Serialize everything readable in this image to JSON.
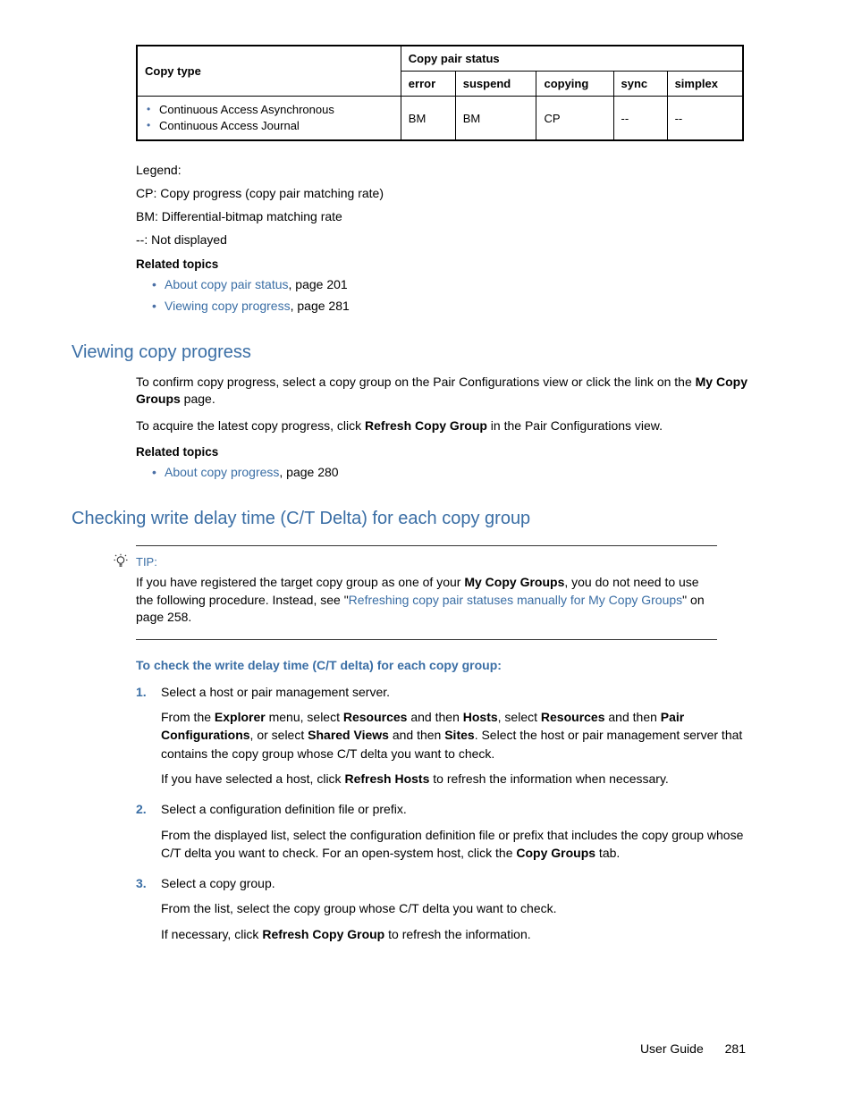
{
  "table": {
    "header_copy_type": "Copy type",
    "header_pair_status": "Copy pair status",
    "cols": {
      "error": "error",
      "suspend": "suspend",
      "copying": "copying",
      "sync": "sync",
      "simplex": "simplex"
    },
    "row_items": [
      "Continuous Access Asynchronous",
      "Continuous Access Journal"
    ],
    "row_vals": {
      "error": "BM",
      "suspend": "BM",
      "copying": "CP",
      "sync": "--",
      "simplex": "--"
    }
  },
  "legend": {
    "label": "Legend:",
    "l1": "CP: Copy progress (copy pair matching rate)",
    "l2": "BM: Differential-bitmap matching rate",
    "l3": "--: Not displayed"
  },
  "related_topics_heading": "Related topics",
  "related1": {
    "items": [
      {
        "link": "About copy pair status",
        "rest": ", page 201"
      },
      {
        "link": "Viewing copy progress",
        "rest": ", page 281"
      }
    ]
  },
  "sec1": {
    "heading": "Viewing copy progress",
    "p1a": "To confirm copy progress, select a copy group on the Pair Configurations view or click the link on the ",
    "p1b_bold": "My Copy Groups",
    "p1c": " page.",
    "p2a": "To acquire the latest copy progress, click ",
    "p2b_bold": "Refresh Copy Group",
    "p2c": " in the Pair Configurations view.",
    "related": {
      "link": "About copy progress",
      "rest": ", page 280"
    }
  },
  "sec2": {
    "heading": "Checking write delay time (C/T Delta) for each copy group",
    "tip_label": "TIP:",
    "tip_a": "If you have registered the target copy group as one of your ",
    "tip_b_bold": "My Copy Groups",
    "tip_c": ", you do not need to use the following procedure. Instead, see \"",
    "tip_link": "Refreshing copy pair statuses manually for My Copy Groups",
    "tip_d": "\" on page 258.",
    "proc_heading": "To check the write delay time (C/T delta) for each copy group:",
    "steps": {
      "s1": {
        "lead": "Select a host or pair management server.",
        "p1_a": "From the ",
        "p1_b_bold": "Explorer",
        "p1_c": " menu, select ",
        "p1_d_bold": "Resources",
        "p1_e": " and then ",
        "p1_f_bold": "Hosts",
        "p1_g": ", select ",
        "p1_h_bold": "Resources",
        "p1_i": " and then ",
        "p1_j_bold": "Pair Configurations",
        "p1_k": ", or select ",
        "p1_l_bold": "Shared Views",
        "p1_m": " and then ",
        "p1_n_bold": "Sites",
        "p1_o": ". Select the host or pair management server that contains the copy group whose C/T delta you want to check.",
        "p2_a": "If you have selected a host, click ",
        "p2_b_bold": "Refresh Hosts",
        "p2_c": " to refresh the information when necessary."
      },
      "s2": {
        "lead": "Select a configuration definition file or prefix.",
        "p1_a": "From the displayed list, select the configuration definition file or prefix that includes the copy group whose C/T delta you want to check. For an open-system host, click the ",
        "p1_b_bold": "Copy Groups",
        "p1_c": " tab."
      },
      "s3": {
        "lead": "Select a copy group.",
        "p1": "From the list, select the copy group whose C/T delta you want to check.",
        "p2_a": "If necessary, click ",
        "p2_b_bold": "Refresh Copy Group",
        "p2_c": " to refresh the information."
      }
    }
  },
  "footer": {
    "doc": "User Guide",
    "page": "281"
  }
}
